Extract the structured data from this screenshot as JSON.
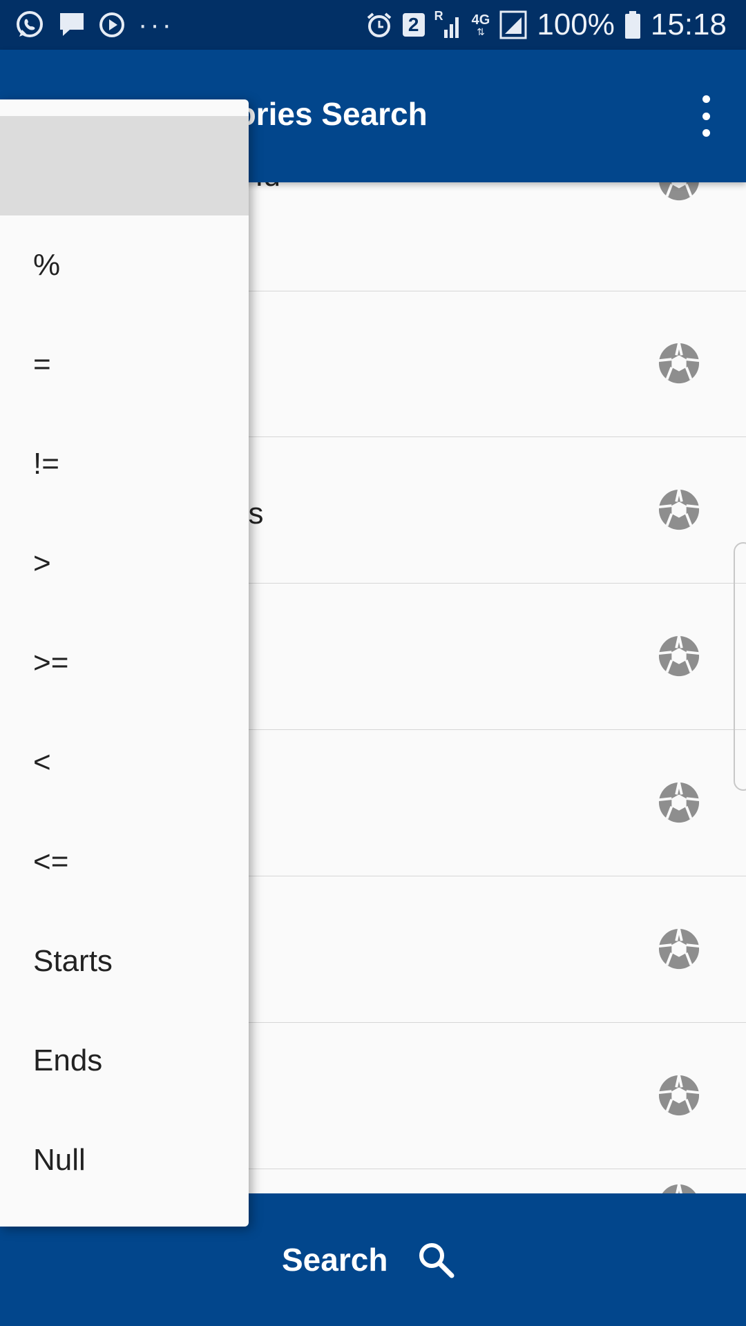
{
  "status_bar": {
    "left_icons": [
      "whatsapp-icon",
      "message-icon",
      "media-icon"
    ],
    "more_dots": "···",
    "sim_badge": "2",
    "network_r": "R",
    "network_4g": "4G",
    "battery_percent": "100%",
    "time": "15:18"
  },
  "app_bar": {
    "title": "ventories Search",
    "menu_icon": "more-vertical-icon"
  },
  "list": {
    "rows": [
      {
        "label": "s Id"
      },
      {
        "label": ""
      },
      {
        "label": "es"
      },
      {
        "label": ""
      },
      {
        "label": ""
      },
      {
        "label": ""
      },
      {
        "label": ""
      },
      {
        "label": ""
      }
    ],
    "row_icon": "shutter-icon"
  },
  "dropdown": {
    "items": [
      {
        "label": ""
      },
      {
        "label": "%"
      },
      {
        "label": "="
      },
      {
        "label": "!="
      },
      {
        "label": ">"
      },
      {
        "label": ">="
      },
      {
        "label": "<"
      },
      {
        "label": "<="
      },
      {
        "label": "Starts"
      },
      {
        "label": "Ends"
      },
      {
        "label": "Null"
      }
    ],
    "selected_index": 0
  },
  "bottom_bar": {
    "label": "Search",
    "icon": "search-icon"
  },
  "colors": {
    "status_bar": "#023066",
    "app_bar": "#02468c",
    "icon_gray": "#8e8e8e"
  }
}
